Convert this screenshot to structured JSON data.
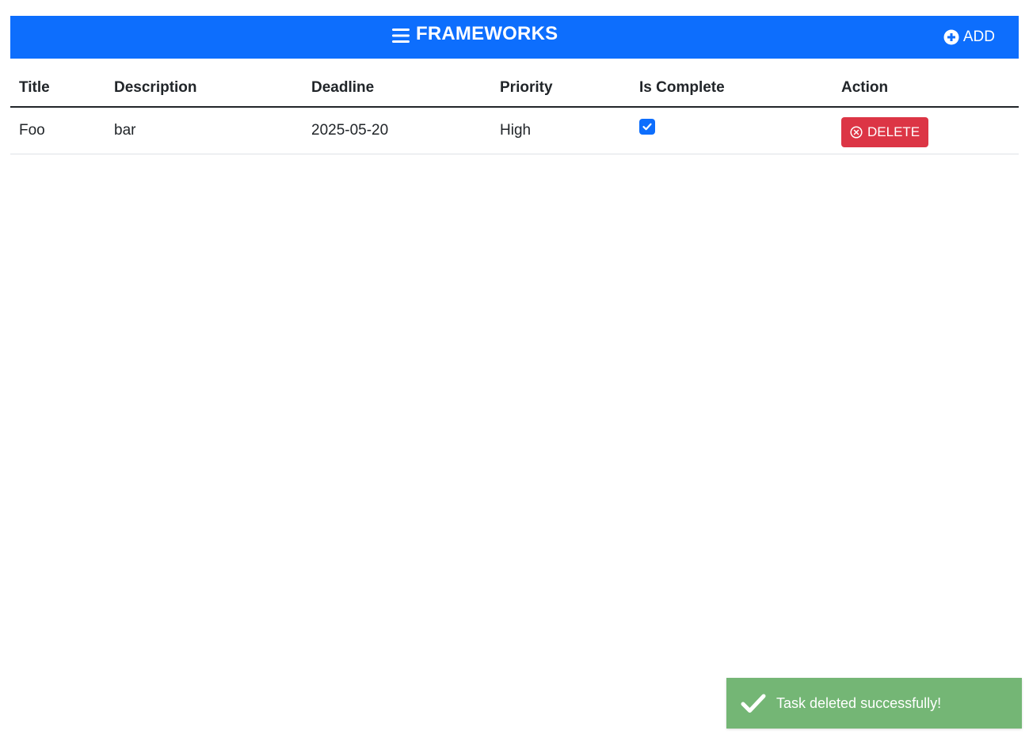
{
  "header": {
    "title": "FRAMEWORKS",
    "add_label": "ADD",
    "color": "#0d6efd"
  },
  "table": {
    "columns": [
      "Title",
      "Description",
      "Deadline",
      "Priority",
      "Is Complete",
      "Action"
    ],
    "rows": [
      {
        "title": "Foo",
        "description": "bar",
        "deadline": "2025-05-20",
        "priority": "High",
        "is_complete": true,
        "action_label": "DELETE"
      }
    ]
  },
  "toast": {
    "message": "Task deleted successfully!",
    "icon": "checkmark-icon",
    "color": "#74b675"
  },
  "icons": {
    "menu": "menu-icon",
    "add": "plus-circle-icon",
    "delete": "x-circle-icon",
    "check": "checkmark-icon"
  },
  "colors": {
    "danger": "#dc3545",
    "primary": "#0d6efd"
  }
}
